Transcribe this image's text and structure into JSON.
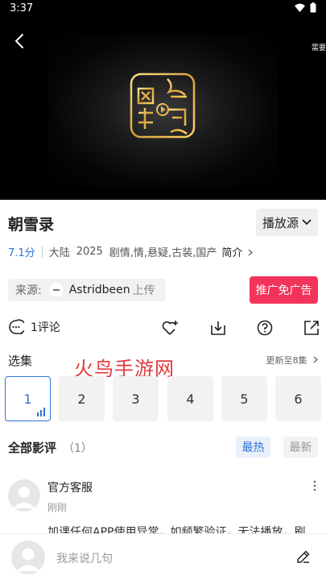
{
  "status_bar": {
    "time": "3:37"
  },
  "player": {
    "corner_label": "需要"
  },
  "show": {
    "title": "朝雪录",
    "play_source_label": "播放源",
    "score": "7.1分",
    "region": "大陆",
    "year": "2025",
    "genres": "剧情,情,悬疑,古装,国产",
    "intro_label": "简介"
  },
  "source": {
    "label": "来源:",
    "uploader": "Astridbeen",
    "upload_suffix": "上传"
  },
  "ad_button": "推广免广告",
  "actions": {
    "comment_count": "1评论"
  },
  "episodes": {
    "title": "选集",
    "update_info": "更新至8集",
    "items": [
      "1",
      "2",
      "3",
      "4",
      "5",
      "6"
    ],
    "active_index": 0
  },
  "watermark": "火鸟手游网",
  "reviews": {
    "title": "全部影评",
    "count": "（1）",
    "tab_hot": "最热",
    "tab_new": "最新",
    "first": {
      "user": "官方客服",
      "time": "刚刚",
      "text": "加课任何APP使用异常，如频繁验证，无法播放，刷"
    }
  },
  "bottom_bar": {
    "placeholder": "我来说几句"
  },
  "colors": {
    "accent": "#2b73d6",
    "ad_red": "#f2335a",
    "watermark_red": "#e23b3b"
  }
}
